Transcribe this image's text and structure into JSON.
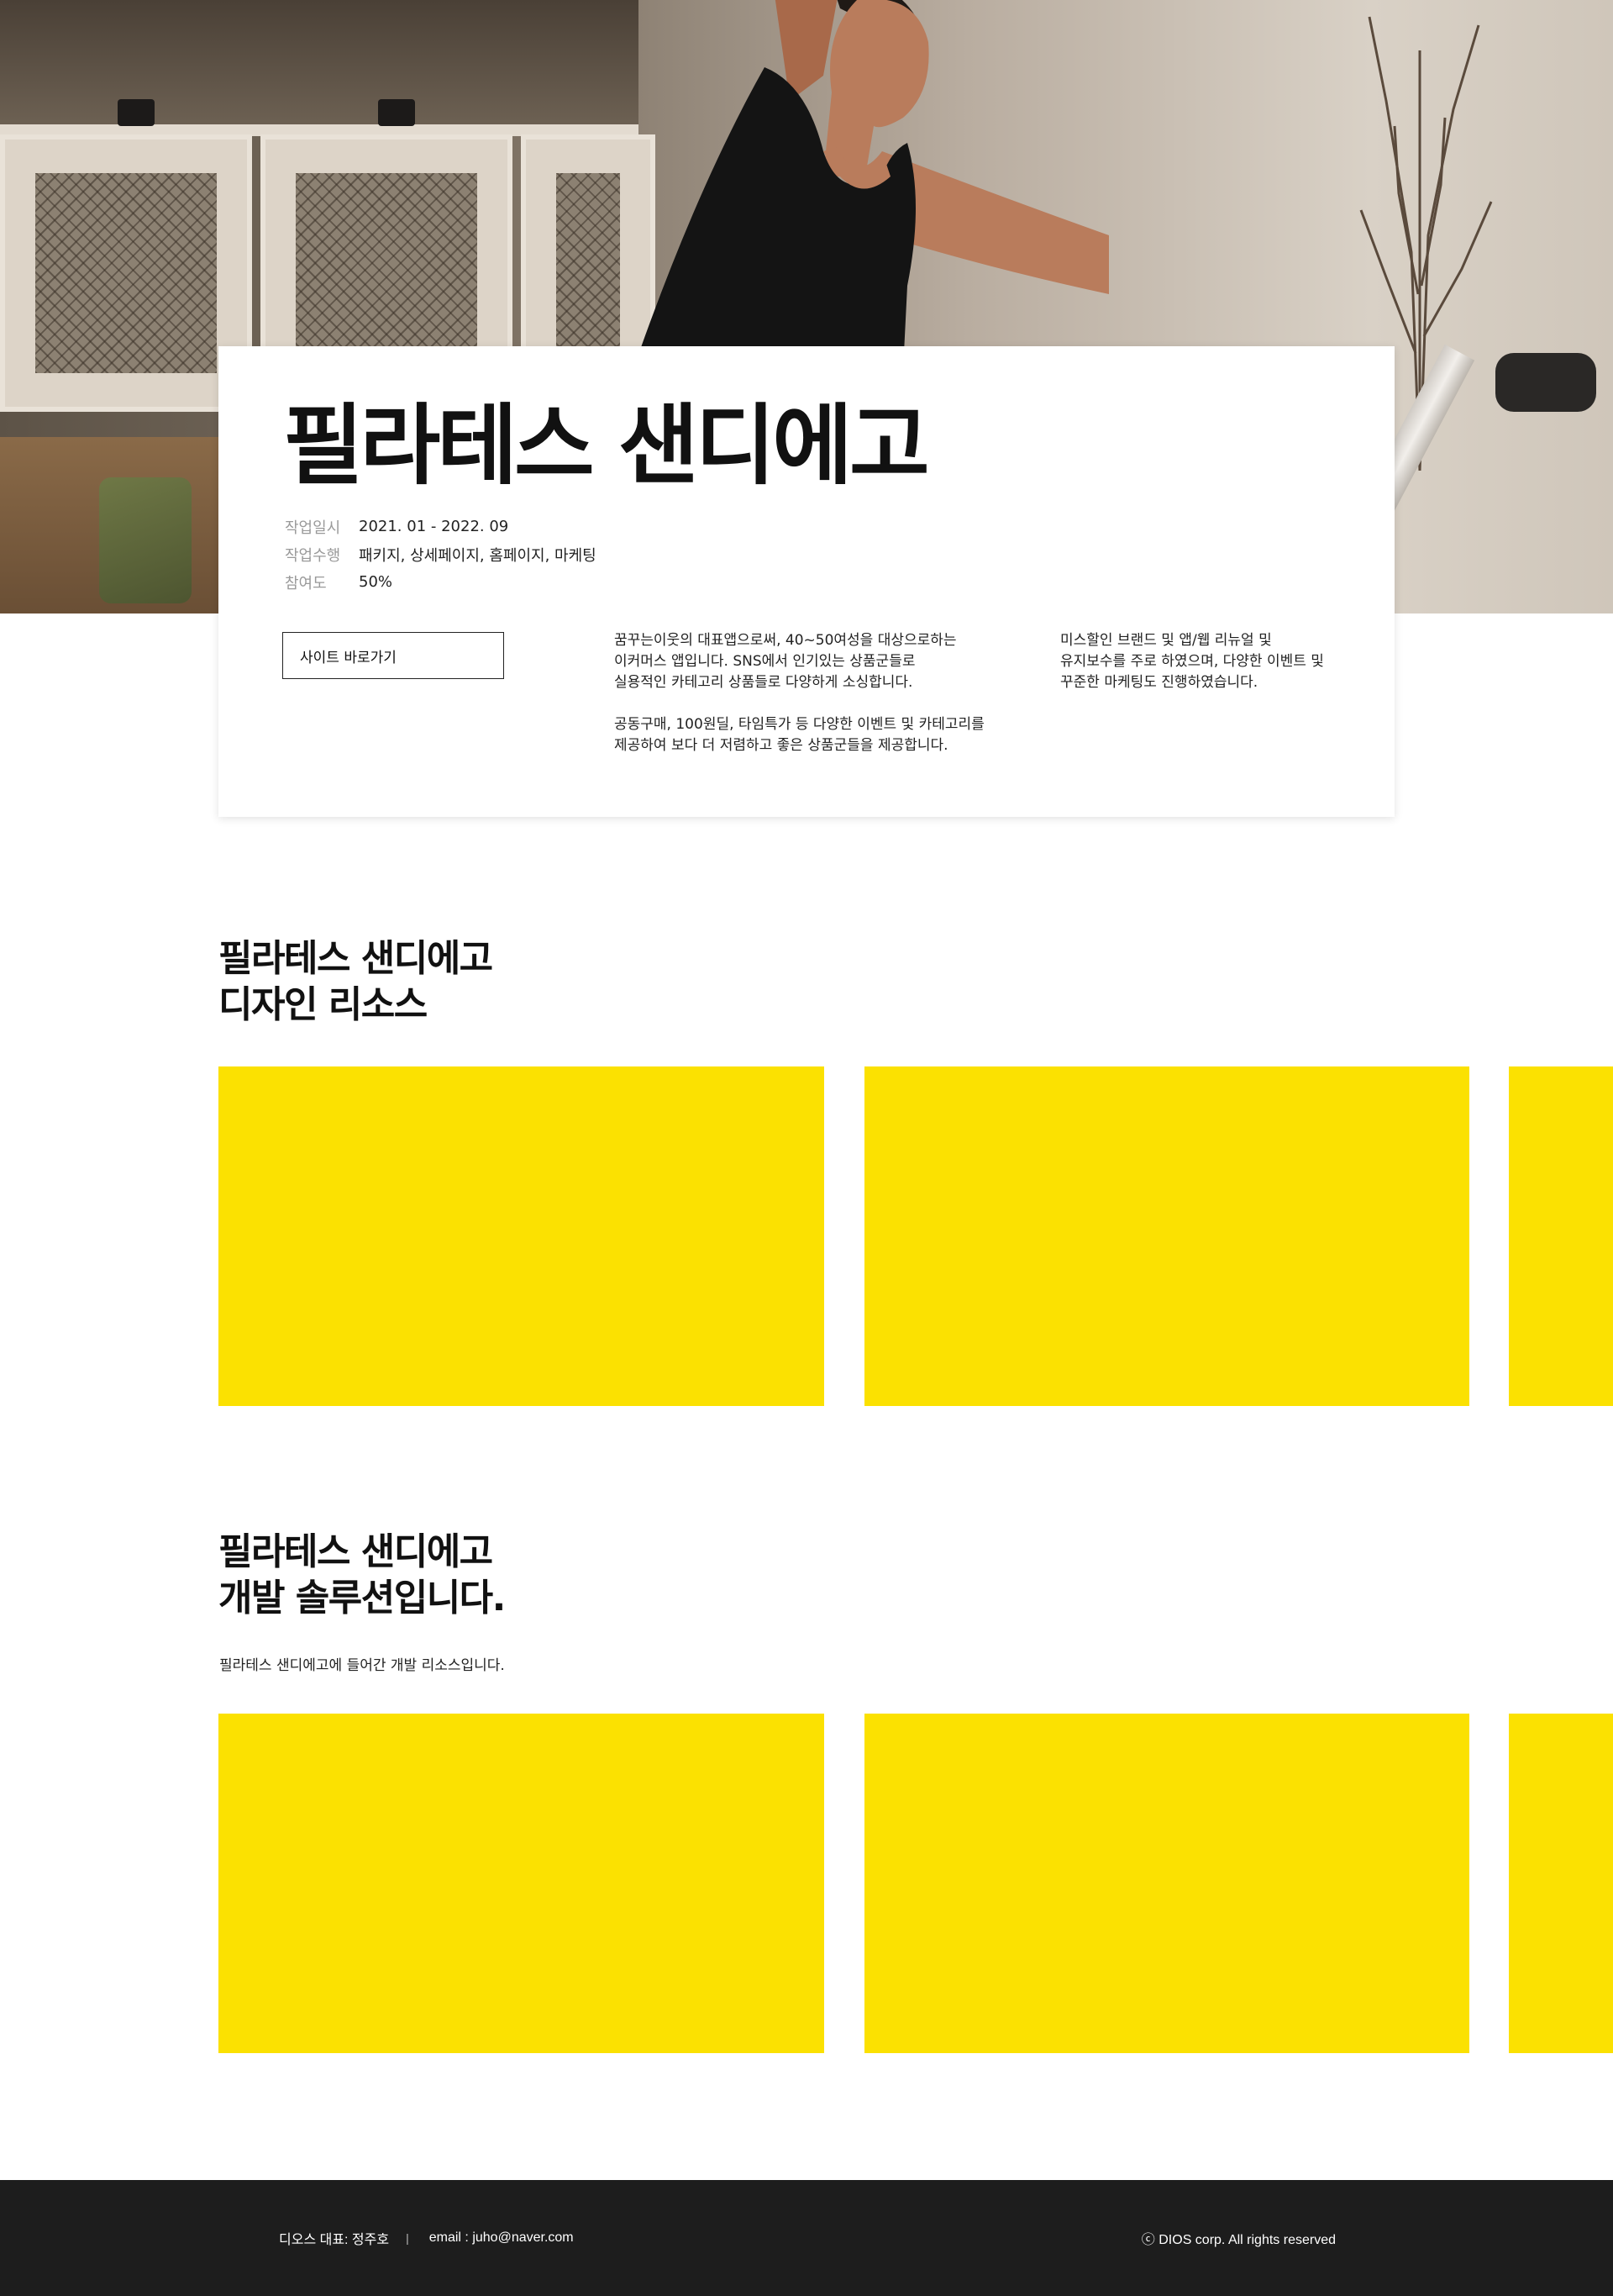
{
  "hero": {
    "image_alt": "pilates-woman-stretching-photo"
  },
  "card": {
    "title": "필라테스 샌디에고",
    "meta": [
      {
        "key": "작업일시",
        "value": "2021. 01 - 2022. 09"
      },
      {
        "key": "작업수행",
        "value": "패키지, 상세페이지, 홈페이지, 마케팅"
      },
      {
        "key": "참여도",
        "value": "50%"
      }
    ],
    "site_button_label": "사이트 바로가기",
    "description_1": "꿈꾸는이웃의 대표앱으로써, 40~50여성을 대상으로하는\n이커머스 앱입니다. SNS에서 인기있는 상품군들로\n실용적인 카테고리 상품들로 다양하게 소싱합니다.\n\n공동구매, 100원딜, 타임특가 등 다양한 이벤트 및 카테고리를\n제공하여 보다 더 저렴하고 좋은 상품군들을 제공합니다.",
    "description_2": "미스할인 브랜드 및 앱/웹 리뉴얼 및\n유지보수를 주로 하였으며, 다양한 이벤트 및\n꾸준한 마케팅도 진행하였습니다."
  },
  "design_section": {
    "title": "필라테스 샌디에고\n디자인 리소스"
  },
  "dev_section": {
    "title": "필라테스 샌디에고\n개발 솔루션입니다.",
    "subtitle": "필라테스 샌디에고에 들어간 개발 리소스입니다."
  },
  "colors": {
    "tile": "#fbe101",
    "footer_bg": "#1d1d1d"
  },
  "footer": {
    "ceo": "디오스 대표: 정주호",
    "separator": "|",
    "email": "email : juho@naver.com",
    "copyright": "ⓒ DIOS corp. All rights reserved"
  }
}
